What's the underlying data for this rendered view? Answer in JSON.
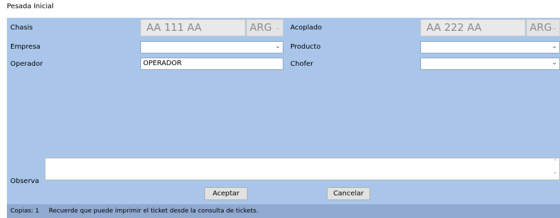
{
  "window": {
    "title": "Pesada Inicial"
  },
  "form": {
    "chasis": {
      "label": "Chasis",
      "plate": "AA 111 AA",
      "country": "ARG"
    },
    "acoplado": {
      "label": "Acoplado",
      "plate": "AA 222 AA",
      "country": "ARG"
    },
    "empresa": {
      "label": "Empresa",
      "value": ""
    },
    "producto": {
      "label": "Producto",
      "value": ""
    },
    "operador": {
      "label": "Operador",
      "value": "OPERADOR"
    },
    "chofer": {
      "label": "Chofer",
      "value": ""
    },
    "observa": {
      "label": "Observa",
      "value": ""
    }
  },
  "buttons": {
    "accept": "Aceptar",
    "cancel": "Cancelar"
  },
  "status": {
    "copies": "Copias: 1",
    "message": "Recuerde que puede imprimir el ticket desde la consulta de tickets."
  },
  "icons": {
    "dropdown": "chevron-down-icon",
    "scroll_up": "scroll-up-icon",
    "scroll_down": "scroll-down-icon"
  }
}
